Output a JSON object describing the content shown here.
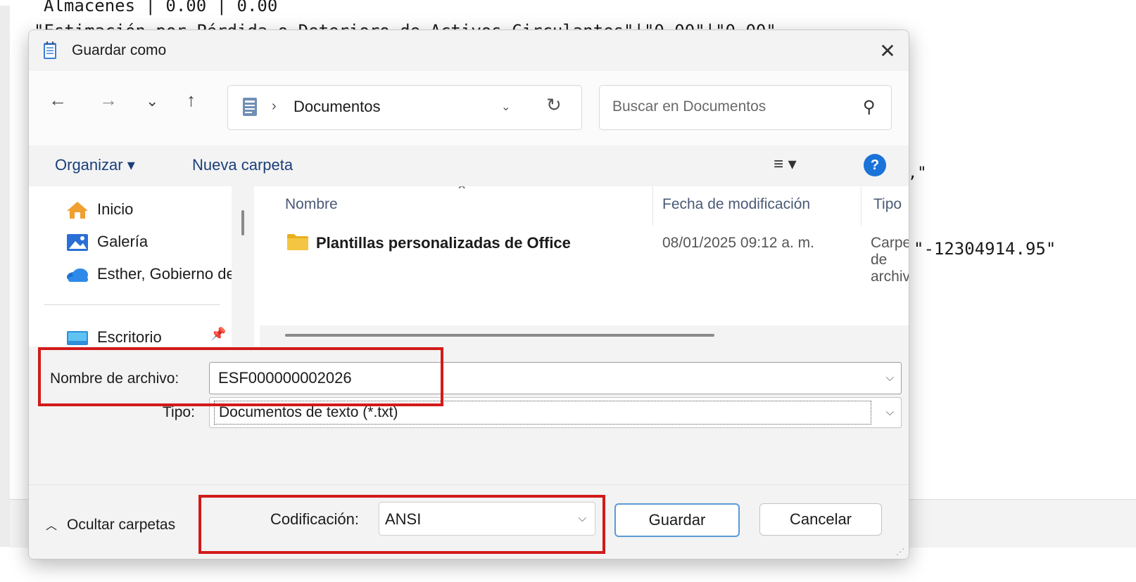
{
  "background": {
    "line1": "Almacenes | 0.00 | 0.00",
    "line2": "\"Estimación por Pérdida o Deterioro de Activos Circulantes\"|\"0.00\"|\"0.00\"",
    "frag1": ",\"",
    "frag2": "\"-12304914.95\""
  },
  "dialog": {
    "title": "Guardar como",
    "close_icon": "close-icon"
  },
  "nav": {
    "back": "←",
    "forward": "→",
    "recent": "⌄",
    "up": "↑",
    "address_separator": "›",
    "address": "Documentos",
    "address_chevron": "⌄",
    "refresh": "↻",
    "search_placeholder": "Buscar en Documentos",
    "search_glyph": "⚲"
  },
  "toolbar": {
    "organize": "Organizar ▾",
    "new_folder": "Nueva carpeta",
    "view": "≡ ▾",
    "help": "?"
  },
  "sidebar": {
    "items": [
      {
        "label": "Inicio",
        "icon": "home-icon"
      },
      {
        "label": "Galería",
        "icon": "gallery-icon"
      },
      {
        "label": "Esther, Gobierno del",
        "icon": "onedrive-cloud-icon"
      },
      {
        "label": "Escritorio",
        "icon": "desktop-icon"
      }
    ]
  },
  "filelist": {
    "columns": [
      "Nombre",
      "Fecha de modificación",
      "Tipo"
    ],
    "rows": [
      {
        "name": "Plantillas personalizadas de Office",
        "date": "08/01/2025 09:12 a. m.",
        "type": "Carpeta de archivos"
      }
    ]
  },
  "form": {
    "filename_label": "Nombre de archivo:",
    "filename_value": "ESF000000002026",
    "type_label": "Tipo:",
    "type_value": "Documentos de texto (*.txt)"
  },
  "footer": {
    "hide_folders": "Ocultar carpetas",
    "encoding_label": "Codificación:",
    "encoding_value": "ANSI",
    "save": "Guardar",
    "cancel": "Cancelar"
  },
  "colors": {
    "annotation": "#d21a1a",
    "accent": "#1a73d9",
    "folder": "#f4c542"
  }
}
